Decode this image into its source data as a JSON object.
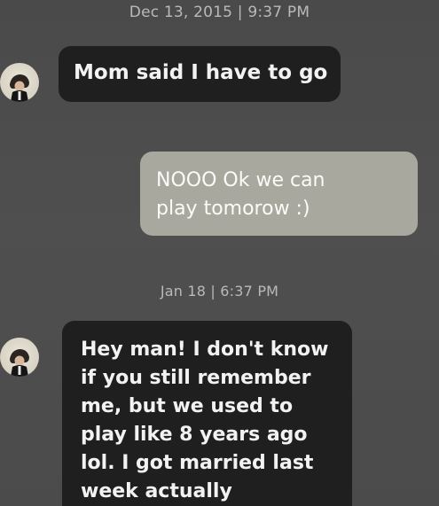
{
  "conversation": {
    "timestamps": [
      "Dec 13, 2015 | 9:37 PM",
      "Jan 18 | 6:37 PM"
    ],
    "messages": [
      {
        "sender": "contact",
        "lines": [
          "Mom said I have to go"
        ]
      },
      {
        "sender": "me",
        "lines": [
          "NOOO Ok we can",
          "play tomorow :)"
        ]
      },
      {
        "sender": "contact",
        "lines": [
          "Hey man! I don't know",
          "if you still remember",
          "me, but we used to",
          "play like 8 years ago",
          "lol. I got married last",
          "week actually"
        ]
      }
    ],
    "avatar_icon": "contact-avatar-icon"
  },
  "colors": {
    "background": "#4d4d4d",
    "incoming_bubble": "#1f1f1f",
    "outgoing_bubble": "#a9a89f",
    "timestamp_text": "#b9b9b9"
  }
}
